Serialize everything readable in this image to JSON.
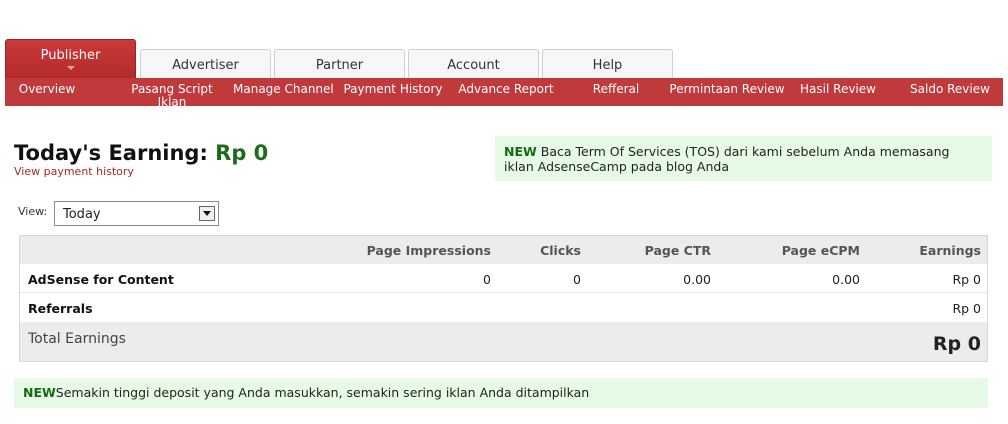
{
  "tabs": [
    "Publisher",
    "Advertiser",
    "Partner",
    "Account",
    "Help"
  ],
  "subnav": [
    "Overview",
    "Pasang Script Iklan",
    "Manage Channel",
    "Payment History",
    "Advance Report",
    "Refferal",
    "Permintaan Review",
    "Hasil Review",
    "Saldo Review"
  ],
  "heading": {
    "label": "Today's Earning:",
    "amount": "Rp 0",
    "link": "View payment history"
  },
  "notice_top": {
    "tag": "NEW",
    "text": " Baca Term Of Services (TOS) dari kami sebelum Anda memasang iklan AdsenseCamp pada blog Anda"
  },
  "view": {
    "label": "View:",
    "selected": "Today"
  },
  "table": {
    "columns": [
      "Page Impressions",
      "Clicks",
      "Page CTR",
      "Page eCPM",
      "Earnings"
    ],
    "rows": [
      {
        "name": "AdSense for Content",
        "impressions": "0",
        "clicks": "0",
        "ctr": "0.00",
        "ecpm": "0.00",
        "earnings": "Rp 0"
      },
      {
        "name": "Referrals",
        "impressions": "",
        "clicks": "",
        "ctr": "",
        "ecpm": "",
        "earnings": "Rp 0"
      }
    ],
    "total": {
      "label": "Total Earnings",
      "value": "Rp 0"
    }
  },
  "notice_bottom": {
    "tag": "NEW",
    "text": "Semakin tinggi deposit yang Anda masukkan, semakin sering iklan Anda ditampilkan"
  },
  "colors": {
    "brand_red": "#c0393b",
    "money_green": "#1e6b1e",
    "notice_bg": "#e6fbe6"
  }
}
